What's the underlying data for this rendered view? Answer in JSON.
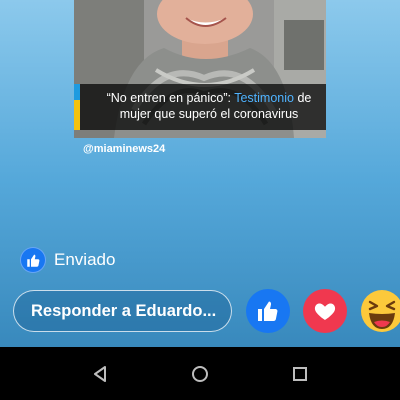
{
  "story": {
    "caption_quote": "“No entren en pánico”: ",
    "caption_highlight": "Testimonio",
    "caption_line1_end": " de",
    "caption_line2": "mujer que superó el coronavirus",
    "source_handle": "@miaminews24",
    "caption_highlight_color": "#4fb3ff"
  },
  "status": {
    "sent_label": "Enviado",
    "icon": "thumbs-up-icon"
  },
  "reply": {
    "placeholder": "Responder a Eduardo..."
  },
  "reactions": [
    {
      "name": "like",
      "icon": "thumbs-up-icon",
      "color": "#1877f2"
    },
    {
      "name": "love",
      "icon": "heart-icon",
      "color": "#f0384f"
    },
    {
      "name": "haha",
      "icon": "laughing-face-icon",
      "color": "#fcc93b"
    }
  ],
  "nav": {
    "back_icon": "back-triangle-icon",
    "home_icon": "home-circle-icon",
    "recents_icon": "recents-square-icon"
  }
}
